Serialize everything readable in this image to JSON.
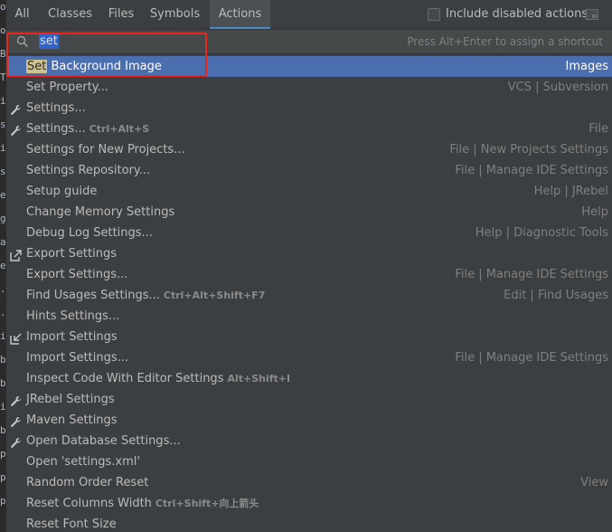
{
  "tabs": [
    {
      "label": "All"
    },
    {
      "label": "Classes"
    },
    {
      "label": "Files"
    },
    {
      "label": "Symbols"
    },
    {
      "label": "Actions"
    }
  ],
  "active_tab": "Actions",
  "include_disabled": {
    "label": "Include disabled actions",
    "checked": false
  },
  "search": {
    "value": "set",
    "hint": "Press Alt+Enter to assign a shortcut"
  },
  "results": [
    {
      "pre": "",
      "match": "Set",
      "post": " Background Image",
      "shortcut": "",
      "location": "Images",
      "icon": "",
      "selected": true
    },
    {
      "pre": "",
      "match": "",
      "post": "Set Property...",
      "shortcut": "",
      "location": "VCS | Subversion",
      "icon": ""
    },
    {
      "pre": "",
      "match": "",
      "post": "Settings...",
      "shortcut": "",
      "location": "",
      "icon": "wrench-icon"
    },
    {
      "pre": "",
      "match": "",
      "post": "Settings...",
      "shortcut": "Ctrl+Alt+S",
      "location": "File",
      "icon": "wrench-icon"
    },
    {
      "pre": "",
      "match": "",
      "post": "Settings for New Projects...",
      "shortcut": "",
      "location": "File | New Projects Settings",
      "icon": ""
    },
    {
      "pre": "",
      "match": "",
      "post": "Settings Repository...",
      "shortcut": "",
      "location": "File | Manage IDE Settings",
      "icon": ""
    },
    {
      "pre": "",
      "match": "",
      "post": "Setup guide",
      "shortcut": "",
      "location": "Help | JRebel",
      "icon": ""
    },
    {
      "pre": "",
      "match": "",
      "post": "Change Memory Settings",
      "shortcut": "",
      "location": "Help",
      "icon": ""
    },
    {
      "pre": "",
      "match": "",
      "post": "Debug Log Settings...",
      "shortcut": "",
      "location": "Help | Diagnostic Tools",
      "icon": ""
    },
    {
      "pre": "",
      "match": "",
      "post": "Export Settings",
      "shortcut": "",
      "location": "",
      "icon": "export-icon"
    },
    {
      "pre": "",
      "match": "",
      "post": "Export Settings...",
      "shortcut": "",
      "location": "File | Manage IDE Settings",
      "icon": ""
    },
    {
      "pre": "",
      "match": "",
      "post": "Find Usages Settings...",
      "shortcut": "Ctrl+Alt+Shift+F7",
      "location": "Edit | Find Usages",
      "icon": ""
    },
    {
      "pre": "",
      "match": "",
      "post": "Hints Settings...",
      "shortcut": "",
      "location": "",
      "icon": ""
    },
    {
      "pre": "",
      "match": "",
      "post": "Import Settings",
      "shortcut": "",
      "location": "",
      "icon": "import-icon"
    },
    {
      "pre": "",
      "match": "",
      "post": "Import Settings...",
      "shortcut": "",
      "location": "File | Manage IDE Settings",
      "icon": ""
    },
    {
      "pre": "",
      "match": "",
      "post": "Inspect Code With Editor Settings",
      "shortcut": "Alt+Shift+I",
      "location": "",
      "icon": ""
    },
    {
      "pre": "",
      "match": "",
      "post": "JRebel Settings",
      "shortcut": "",
      "location": "",
      "icon": "wrench-icon"
    },
    {
      "pre": "",
      "match": "",
      "post": "Maven Settings",
      "shortcut": "",
      "location": "",
      "icon": "wrench-icon"
    },
    {
      "pre": "",
      "match": "",
      "post": "Open Database Settings...",
      "shortcut": "",
      "location": "",
      "icon": "wrench-icon"
    },
    {
      "pre": "",
      "match": "",
      "post": "Open 'settings.xml'",
      "shortcut": "",
      "location": "",
      "icon": ""
    },
    {
      "pre": "",
      "match": "",
      "post": "Random Order Reset",
      "shortcut": "",
      "location": "View",
      "icon": ""
    },
    {
      "pre": "",
      "match": "",
      "post": "Reset Columns Width",
      "shortcut": "Ctrl+Shift+向上箭头",
      "location": "",
      "icon": ""
    },
    {
      "pre": "",
      "match": "",
      "post": "Reset Font Size",
      "shortcut": "",
      "location": "",
      "icon": ""
    }
  ],
  "gutter_chars": [
    "o",
    "o",
    "B",
    "T",
    "i",
    "s",
    "i",
    "s",
    "e",
    "g",
    "a",
    "e",
    ".",
    ".",
    "i",
    "b",
    "b",
    "i",
    "b",
    "p",
    "p",
    "p"
  ],
  "colors": {
    "background": "#3c3f41",
    "selection": "#4b6eaf",
    "match_highlight": "#cfc28a",
    "annotation_box": "#e8261c"
  }
}
